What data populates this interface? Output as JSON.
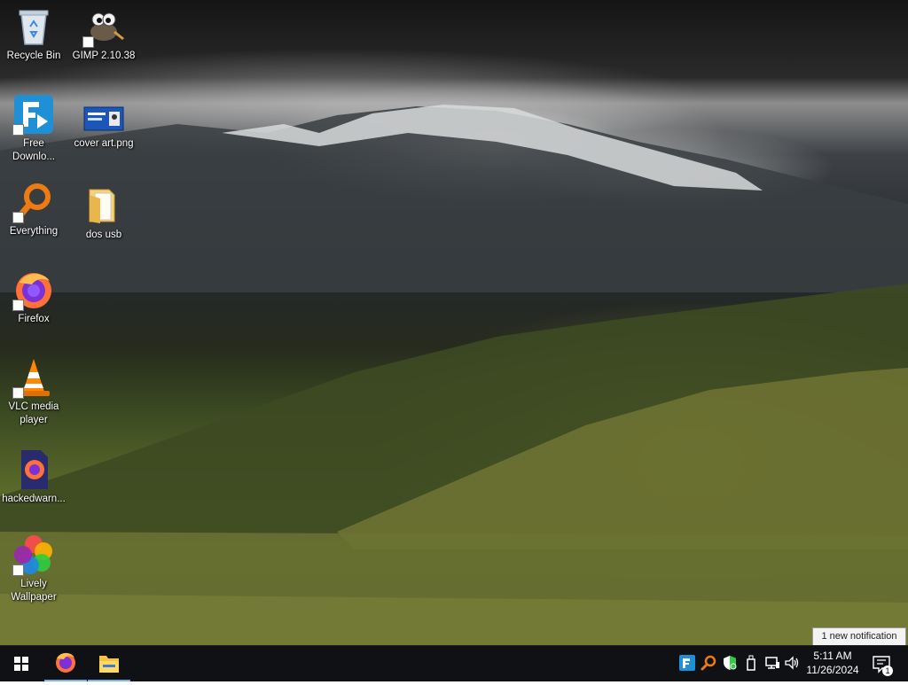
{
  "desktop": {
    "icons": [
      {
        "label": "Recycle Bin"
      },
      {
        "label": "GIMP 2.10.38"
      },
      {
        "label": "Free Downlo..."
      },
      {
        "label": "cover art.png"
      },
      {
        "label": "Everything"
      },
      {
        "label": "dos usb"
      },
      {
        "label": "Firefox"
      },
      {
        "label": "VLC media player"
      },
      {
        "label": "hackedwarn..."
      },
      {
        "label": "Lively Wallpaper"
      }
    ]
  },
  "taskbar": {
    "start_icon": "windows-logo-icon",
    "pinned": [
      {
        "name": "Firefox",
        "icon": "firefox-icon",
        "active": true
      },
      {
        "name": "File Explorer",
        "icon": "folder-icon",
        "active": true
      }
    ],
    "tray_icons": [
      "free-download-manager-icon",
      "everything-search-icon",
      "security-shield-icon",
      "usb-drive-icon",
      "network-icon",
      "volume-icon"
    ],
    "clock": {
      "time": "5:11 AM",
      "date": "11/26/2024"
    },
    "notification": {
      "text": "1 new notification",
      "count": "1"
    }
  },
  "colors": {
    "taskbar": "#101114",
    "accent": "#7cb1e8"
  }
}
